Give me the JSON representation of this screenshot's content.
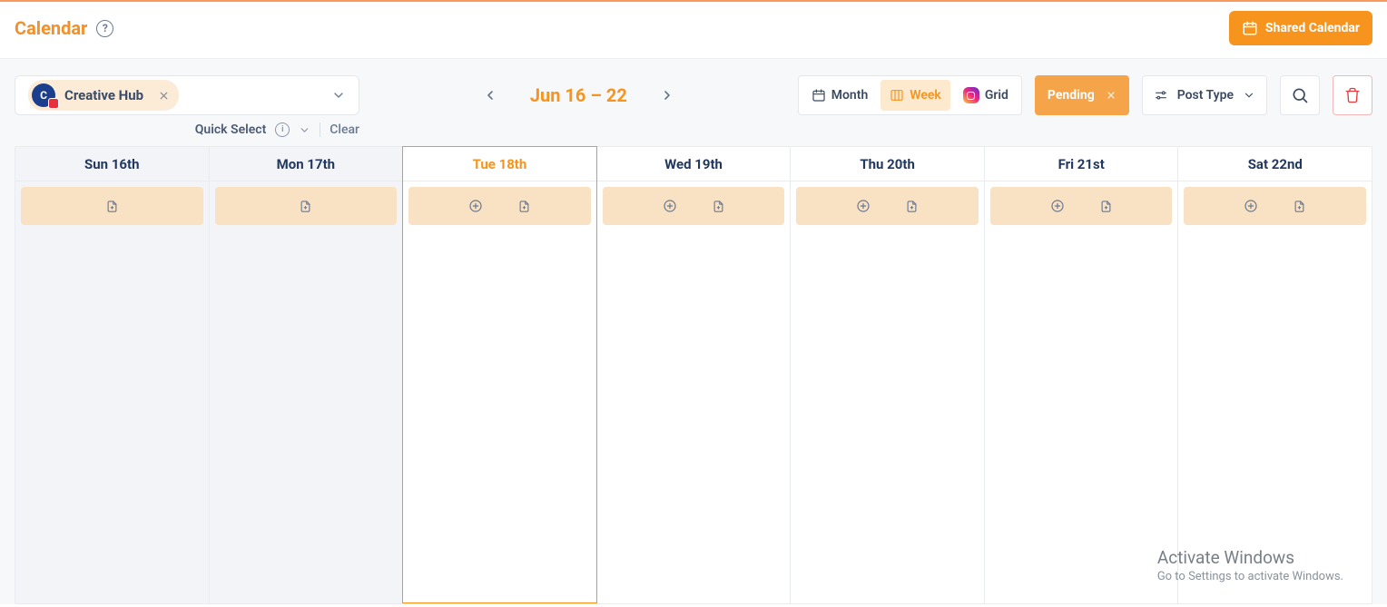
{
  "header": {
    "title": "Calendar",
    "shared_btn": "Shared Calendar"
  },
  "workspace": {
    "name": "Creative Hub",
    "avatar_letter": "C"
  },
  "date_nav": {
    "range": "Jun 16 – 22"
  },
  "views": {
    "month": "Month",
    "week": "Week",
    "grid": "Grid"
  },
  "filters": {
    "pending": "Pending",
    "post_type": "Post Type"
  },
  "quick_select": {
    "label": "Quick Select",
    "clear": "Clear"
  },
  "days": [
    {
      "label": "Sun 16th",
      "past": true,
      "today": false,
      "has_add": false
    },
    {
      "label": "Mon 17th",
      "past": true,
      "today": false,
      "has_add": false
    },
    {
      "label": "Tue 18th",
      "past": false,
      "today": true,
      "has_add": true
    },
    {
      "label": "Wed 19th",
      "past": false,
      "today": false,
      "has_add": true
    },
    {
      "label": "Thu 20th",
      "past": false,
      "today": false,
      "has_add": true
    },
    {
      "label": "Fri 21st",
      "past": false,
      "today": false,
      "has_add": true
    },
    {
      "label": "Sat 22nd",
      "past": false,
      "today": false,
      "has_add": true
    }
  ],
  "watermark": {
    "line1": "Activate Windows",
    "line2": "Go to Settings to activate Windows."
  }
}
